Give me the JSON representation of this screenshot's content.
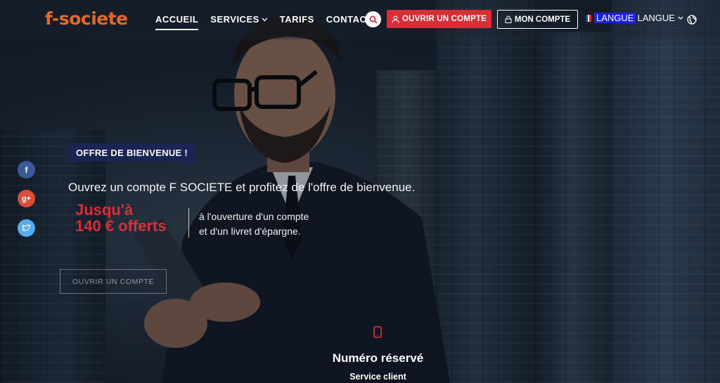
{
  "header": {
    "logo": "f-societe",
    "nav": [
      {
        "label": "ACCUEIL",
        "active": true
      },
      {
        "label": "SERVICES",
        "dropdown": true
      },
      {
        "label": "TARIFS"
      },
      {
        "label": "CONTACT"
      }
    ],
    "open_account_label": "OUVRIR UN COMPTE",
    "my_account_label": "MON COMPTE",
    "language_highlight": "LANGUE",
    "language_label": "LANGUE",
    "search_icon": "search-icon",
    "globe_icon": "globe-icon"
  },
  "social": [
    {
      "icon": "facebook-icon",
      "glyph": "f",
      "color": "#3b5998"
    },
    {
      "icon": "google-plus-icon",
      "glyph": "g+",
      "color": "#dd4b39"
    },
    {
      "icon": "twitter-icon",
      "glyph": "t",
      "color": "#55acee"
    }
  ],
  "hero": {
    "badge": "OFFRE DE BIENVENUE !",
    "lead": "Ouvrez un compte F SOCIETE et profitez de l'offre de bienvenue.",
    "offer_line1": "Jusqu'à",
    "offer_line2": "140 € offerts",
    "offer_desc_line1": "à l'ouverture d'un compte",
    "offer_desc_line2": "et d'un livret d'épargne.",
    "cta_label": "OUVRIR UN COMPTE"
  },
  "contact": {
    "icon": "mobile-phone-icon",
    "title": "Numéro réservé",
    "subtitle": "Service client"
  },
  "colors": {
    "accent_red": "#d72f35",
    "badge_navy": "#1c2453",
    "logo_orange": "#e06a2a",
    "lang_highlight": "#1c22e0"
  }
}
